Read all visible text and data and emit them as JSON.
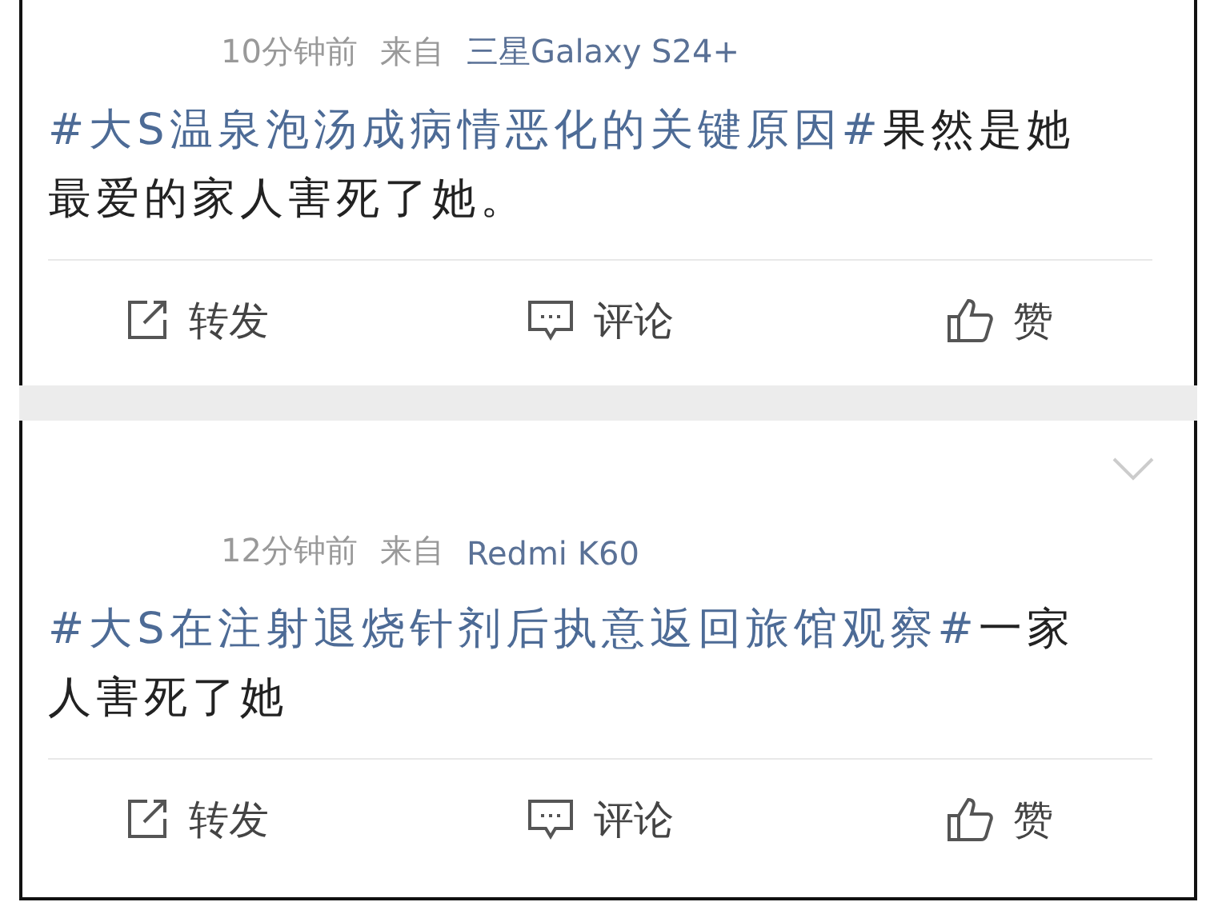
{
  "posts": [
    {
      "time": "10分钟前",
      "source_label": "来自",
      "device": "三星Galaxy S24+",
      "hashtag": "#大S温泉泡汤成病情恶化的关键原因#",
      "text": "果然是她最爱的家人害死了她。",
      "show_chevron": false,
      "actions": [
        {
          "kind": "repost",
          "label": "转发"
        },
        {
          "kind": "comment",
          "label": "评论"
        },
        {
          "kind": "like",
          "label": "赞"
        }
      ]
    },
    {
      "time": "12分钟前",
      "source_label": "来自",
      "device": "Redmi K60",
      "hashtag": "#大S在注射退烧针剂后执意返回旅馆观察#",
      "text": "一家人害死了她",
      "show_chevron": true,
      "actions": [
        {
          "kind": "repost",
          "label": "转发"
        },
        {
          "kind": "comment",
          "label": "评论"
        },
        {
          "kind": "like",
          "label": "赞"
        }
      ]
    }
  ]
}
